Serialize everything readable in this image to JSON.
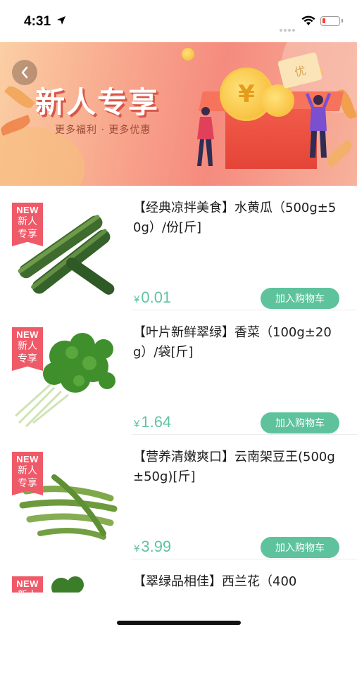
{
  "status_bar": {
    "time": "4:31"
  },
  "banner": {
    "title": "新人专享",
    "subtitle": "更多福利 · 更多优惠",
    "coupon_text": "优"
  },
  "badge": {
    "new": "NEW",
    "line1": "新人",
    "line2": "专享"
  },
  "products": [
    {
      "title": "【经典凉拌美食】水黄瓜（500g±50g）/份[斤]",
      "currency": "¥",
      "price": "0.01",
      "button": "加入购物车"
    },
    {
      "title": "【叶片新鲜翠绿】香菜（100g±20g）/袋[斤]",
      "currency": "¥",
      "price": "1.64",
      "button": "加入购物车"
    },
    {
      "title": "【营养清嫩爽口】云南架豆王(500g±50g)[斤]",
      "currency": "¥",
      "price": "3.99",
      "button": "加入购物车"
    },
    {
      "title": "【翠绿品相佳】西兰花（400"
    }
  ],
  "colors": {
    "accent": "#5ec39c",
    "price": "#5fc4a0",
    "badge": "#ef5a69"
  }
}
